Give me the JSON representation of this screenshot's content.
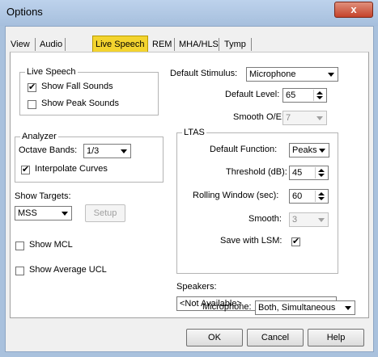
{
  "window": {
    "title": "Options",
    "close_glyph": "x"
  },
  "tabs": [
    "View",
    "Audio",
    "Live Speech",
    "REM",
    "MHA/HLS",
    "Tymp"
  ],
  "live_speech_group": {
    "legend": "Live Speech",
    "show_fall_sounds": {
      "label": "Show Fall Sounds",
      "checked": true
    },
    "show_peak_sounds": {
      "label": "Show Peak Sounds",
      "checked": false
    }
  },
  "analyzer_group": {
    "legend": "Analyzer",
    "octave_bands_label": "Octave Bands:",
    "octave_bands_value": "1/3",
    "interpolate_curves": {
      "label": "Interpolate Curves",
      "checked": true
    }
  },
  "show_targets": {
    "label": "Show Targets:",
    "value": "MSS",
    "setup_label": "Setup"
  },
  "show_mcl": {
    "label": "Show MCL",
    "checked": false
  },
  "show_average_ucl": {
    "label": "Show Average UCL",
    "checked": false
  },
  "default_stimulus": {
    "label": "Default Stimulus:",
    "value": "Microphone"
  },
  "default_level": {
    "label": "Default Level:",
    "value": "65"
  },
  "smooth_oe": {
    "label": "Smooth O/E:",
    "value": "7"
  },
  "ltas_group": {
    "legend": "LTAS",
    "default_function": {
      "label": "Default Function:",
      "value": "Peaks"
    },
    "threshold": {
      "label": "Threshold (dB):",
      "value": "45"
    },
    "rolling_window": {
      "label": "Rolling Window (sec):",
      "value": "60"
    },
    "smooth": {
      "label": "Smooth:",
      "value": "3"
    },
    "save_with_lsm": {
      "label": "Save with LSM:",
      "checked": true
    }
  },
  "speakers": {
    "label": "Speakers:",
    "value": "<Not Available>"
  },
  "microphone": {
    "label": "Microphone:",
    "value": "Both, Simultaneous"
  },
  "footer": {
    "ok": "OK",
    "cancel": "Cancel",
    "help": "Help"
  },
  "colors": {
    "active_tab": "#f3d42f",
    "title_bar": "#a9c1dd",
    "close_button": "#c5432b"
  },
  "check_glyph": "✔"
}
